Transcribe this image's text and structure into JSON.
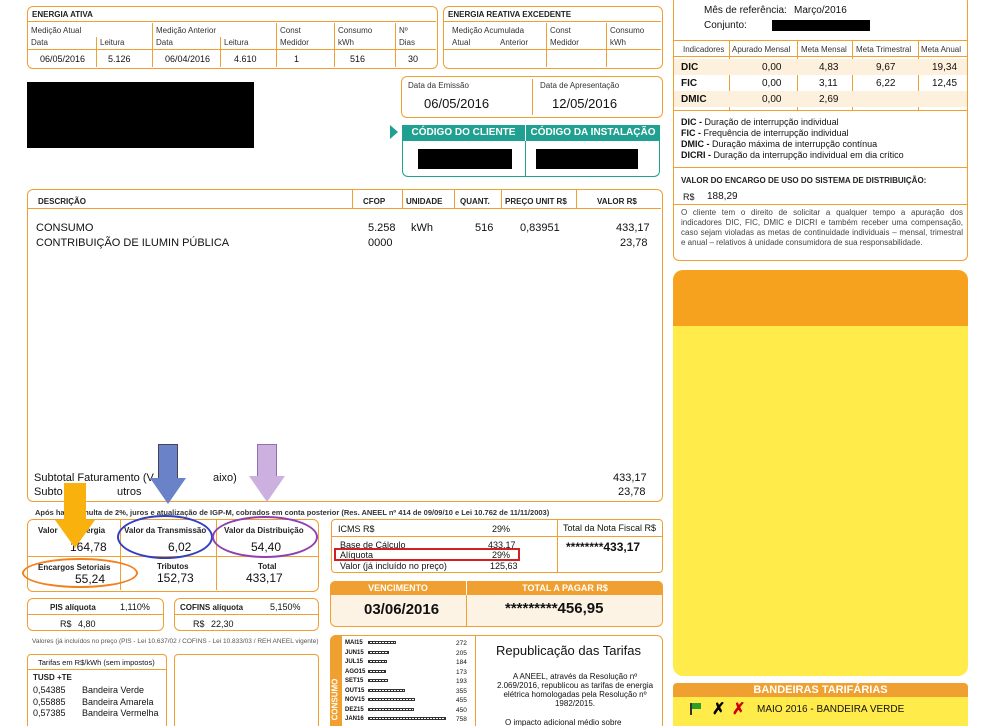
{
  "energia_ativa": {
    "title": "ENERGIA ATIVA",
    "medicao_atual": "Medição Atual",
    "medicao_anterior": "Medição Anterior",
    "const": "Const",
    "medidor": "Medidor",
    "consumo": "Consumo",
    "kwh": "kWh",
    "no": "Nº",
    "dias": "Dias",
    "data": "Data",
    "leitura": "Leitura",
    "data_atual": "06/05/2016",
    "leitura_atual": "5.126",
    "data_anterior": "06/04/2016",
    "leitura_anterior": "4.610",
    "const_val": "1",
    "consumo_val": "516",
    "dias_val": "30"
  },
  "energia_reativa": {
    "title": "ENERGIA REATIVA EXCEDENTE",
    "medicao_acumulada": "Medição Acumulada",
    "atual": "Atual",
    "anterior": "Anterior",
    "const": "Const",
    "medidor": "Medidor",
    "consumo": "Consumo",
    "kwh": "kWh"
  },
  "datas": {
    "emissao_label": "Data da Emissão",
    "emissao": "06/05/2016",
    "apresentacao_label": "Data de Apresentação",
    "apresentacao": "12/05/2016"
  },
  "codigos": {
    "cliente": "CÓDIGO DO CLIENTE",
    "instalacao": "CÓDIGO DA INSTALAÇÃO"
  },
  "referencia": {
    "mes_label": "Mês de referência:",
    "mes": "Março/2016",
    "conjunto_label": "Conjunto:"
  },
  "indicadores": {
    "headers": [
      "Indicadores",
      "Apurado Mensal",
      "Meta Mensal",
      "Meta Trimestral",
      "Meta Anual"
    ],
    "rows": [
      {
        "name": "DIC",
        "apurado": "0,00",
        "mensal": "4,83",
        "trimestral": "9,67",
        "anual": "19,34"
      },
      {
        "name": "FIC",
        "apurado": "0,00",
        "mensal": "3,11",
        "trimestral": "6,22",
        "anual": "12,45"
      },
      {
        "name": "DMIC",
        "apurado": "0,00",
        "mensal": "2,69",
        "trimestral": "",
        "anual": ""
      }
    ],
    "legend": [
      {
        "k": "DIC -",
        "v": " Duração de interrupção individual"
      },
      {
        "k": "FIC -",
        "v": " Frequência de interrupção individual"
      },
      {
        "k": "DMIC -",
        "v": " Duração máxima de interrupção contínua"
      },
      {
        "k": "DICRI -",
        "v": " Duração da interrupção individual em dia crítico"
      }
    ],
    "encargo_label": "VALOR DO ENCARGO DE USO DO SISTEMA DE DISTRIBUIÇÃO:",
    "encargo_currency": "R$",
    "encargo_val": "188,29",
    "nota": "O cliente tem o direito de solicitar a qualquer tempo a apuração dos indicadores DIC, FIC, DMIC e DICRI e também receber uma compensação, caso sejam violadas as metas de continuidade individuais – mensal, trimestral e anual – relativos à unidade consumidora de sua responsabilidade."
  },
  "descricao": {
    "headers": [
      "DESCRIÇÃO",
      "CFOP",
      "UNIDADE",
      "QUANT.",
      "PREÇO UNIT R$",
      "VALOR R$"
    ],
    "items": [
      {
        "desc": "CONSUMO",
        "cfop": "5.258",
        "unid": "kWh",
        "quant": "516",
        "preco": "0,83951",
        "valor": "433,17"
      },
      {
        "desc": "CONTRIBUIÇÃO DE ILUMIN PÚBLICA",
        "cfop": "0000",
        "unid": "",
        "quant": "",
        "preco": "",
        "valor": "23,78"
      }
    ],
    "subtotal_fat": "Subtotal Faturamento (V",
    "subtotal_fat_tail": "aixo)",
    "subtotal_fat_val": "433,17",
    "subtotal_outros": "Subto",
    "subtotal_outros_tail": "utros",
    "subtotal_outros_val": "23,78",
    "multa": "Após                    haverá multa de 2%, juros e atualização de IGP-M, cobrados em conta posterior (Res. ANEEL nº 414 de 09/09/10 e Lei 10.762 de 11/11/2003)"
  },
  "composicao": {
    "energia_label": "Valor",
    "energia_tail": "ergia",
    "energia_val": "164,78",
    "transmissao_label": "Valor da Transmissão",
    "transmissao_val": "6,02",
    "distribuicao_label": "Valor da Distribuição",
    "distribuicao_val": "54,40",
    "encargos_label": "Encargos Setoriais",
    "encargos_val": "55,24",
    "tributos_label": "Tributos",
    "tributos_val": "152,73",
    "total_label": "Total",
    "total_val": "433,17"
  },
  "icms": {
    "label": "ICMS R$",
    "pct": "29%",
    "base_label": "Base de Cálculo",
    "base_val": "433,17",
    "aliquota_label": "Alíquota",
    "aliquota_val": "29%",
    "valor_label": "Valor (já incluído no preço)",
    "valor_val": "125,63",
    "total_nota_label": "Total da Nota Fiscal R$",
    "total_nota_val": "********433,17"
  },
  "pagamento": {
    "vencimento_label": "VENCIMENTO",
    "vencimento": "03/06/2016",
    "total_label": "TOTAL A PAGAR R$",
    "total": "*********456,95"
  },
  "pis": {
    "label": "PIS alíquota",
    "pct": "1,110%",
    "cur": "R$",
    "val": "4,80"
  },
  "cofins": {
    "label": "COFINS alíquota",
    "pct": "5,150%",
    "cur": "R$",
    "val": "22,30"
  },
  "legal_note": "Valores (já incluídos no preço (PIS - Lei 10.637/02 / COFINS - Lei 10.833/03 / REH ANEEL vigente)",
  "tarifas": {
    "title": "Tarifas em R$/kWh (sem impostos)",
    "header": "TUSD +TE",
    "rows": [
      {
        "v": "0,54385",
        "b": "Bandeira Verde"
      },
      {
        "v": "0,55885",
        "b": "Bandeira Amarela"
      },
      {
        "v": "0,57385",
        "b": "Bandeira Vermelha"
      }
    ]
  },
  "consumo_hist": {
    "side_label": "CONSUMO",
    "rows": [
      {
        "m": "MAI15",
        "v": "272"
      },
      {
        "m": "JUN15",
        "v": "205"
      },
      {
        "m": "JUL15",
        "v": "184"
      },
      {
        "m": "AGO15",
        "v": "173"
      },
      {
        "m": "SET15",
        "v": "193"
      },
      {
        "m": "OUT15",
        "v": "355"
      },
      {
        "m": "NOV15",
        "v": "455"
      },
      {
        "m": "DEZ15",
        "v": "450"
      },
      {
        "m": "JAN16",
        "v": "758"
      }
    ]
  },
  "republicacao": {
    "title": "Republicação das Tarifas",
    "text": "A ANEEL, através da Resolução nº 2.069/2016, republicou as tarifas de energia elétrica homologadas pela Resolução nº  1982/2015.",
    "text2": "O impacto adicional médio sobre"
  },
  "bandeiras": {
    "title": "BANDEIRAS TARIFÁRIAS",
    "item": "MAIO 2016 - BANDEIRA VERDE"
  },
  "colors": {
    "orange": "#f0a030",
    "teal": "#20a090",
    "yellow": "#ffec4a"
  }
}
